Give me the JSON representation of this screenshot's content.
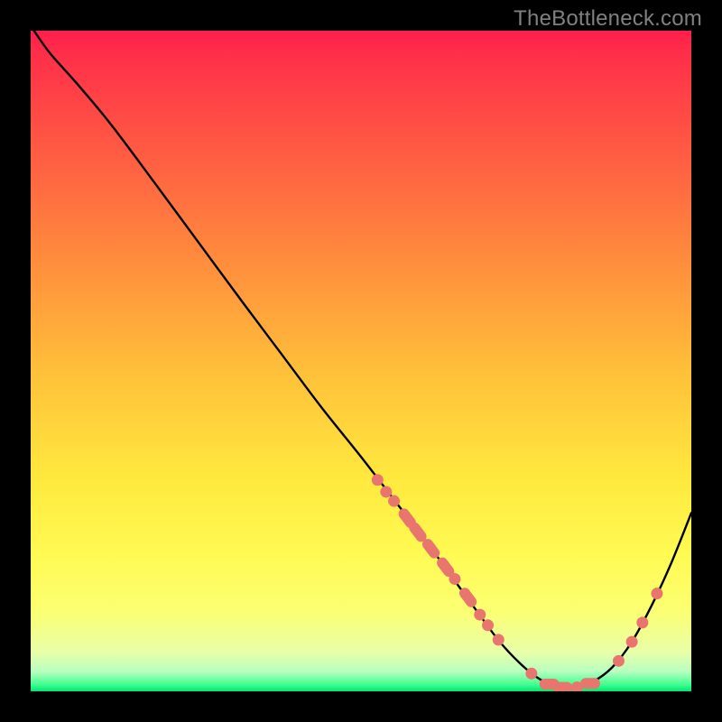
{
  "watermark": "TheBottleneck.com",
  "colors": {
    "gradient_top": "#ff1f4b",
    "gradient_bottom": "#00e472",
    "curve": "#000000",
    "dots": "#e8766e",
    "frame": "#000000",
    "watermark": "#808080"
  },
  "chart_data": {
    "type": "line",
    "title": "",
    "xlabel": "",
    "ylabel": "",
    "xlim": [
      0,
      100
    ],
    "ylim": [
      0,
      100
    ],
    "note": "Axes are unlabeled; values are read as percentage positions within the plot area (0=left/bottom, 100=right/top).",
    "series": [
      {
        "name": "curve",
        "x": [
          0.5,
          3,
          7,
          12,
          18,
          25,
          32,
          38,
          44,
          50,
          55,
          60,
          64,
          68,
          71,
          74,
          76.5,
          79,
          82,
          85,
          88,
          91,
          94,
          97,
          100
        ],
        "y": [
          100,
          96.5,
          92,
          86,
          78,
          68.5,
          59,
          51,
          43,
          35.5,
          29,
          22.5,
          17,
          11.5,
          7.5,
          4.3,
          2.2,
          0.9,
          0.5,
          1.4,
          3.6,
          7.5,
          13,
          19.5,
          27
        ]
      }
    ],
    "markers": [
      {
        "group": "left_cluster",
        "x": 52.5,
        "y": 32,
        "shape": "dot"
      },
      {
        "group": "left_cluster",
        "x": 53.8,
        "y": 30.2,
        "shape": "dot"
      },
      {
        "group": "left_cluster",
        "x": 55.0,
        "y": 28.8,
        "shape": "dot"
      },
      {
        "group": "left_cluster",
        "x": 57.0,
        "y": 26.2,
        "shape": "pill"
      },
      {
        "group": "left_cluster",
        "x": 58.6,
        "y": 24.1,
        "shape": "pill"
      },
      {
        "group": "left_cluster",
        "x": 60.6,
        "y": 21.6,
        "shape": "pill"
      },
      {
        "group": "left_cluster",
        "x": 62.8,
        "y": 18.8,
        "shape": "pill"
      },
      {
        "group": "left_cluster",
        "x": 64.2,
        "y": 17.0,
        "shape": "dot"
      },
      {
        "group": "left_cluster",
        "x": 66.2,
        "y": 14.2,
        "shape": "pill"
      },
      {
        "group": "left_cluster",
        "x": 68.0,
        "y": 11.6,
        "shape": "dot"
      },
      {
        "group": "left_cluster",
        "x": 69.2,
        "y": 10.0,
        "shape": "dot"
      },
      {
        "group": "left_cluster",
        "x": 70.8,
        "y": 7.8,
        "shape": "dot"
      },
      {
        "group": "bottom",
        "x": 75.8,
        "y": 2.7,
        "shape": "dot"
      },
      {
        "group": "bottom",
        "x": 78.5,
        "y": 1.1,
        "shape": "pill_h"
      },
      {
        "group": "bottom",
        "x": 80.5,
        "y": 0.6,
        "shape": "pill_h"
      },
      {
        "group": "bottom",
        "x": 82.7,
        "y": 0.6,
        "shape": "dot"
      },
      {
        "group": "bottom",
        "x": 84.7,
        "y": 1.2,
        "shape": "pill_h"
      },
      {
        "group": "right_cluster",
        "x": 89.0,
        "y": 4.6,
        "shape": "dot"
      },
      {
        "group": "right_cluster",
        "x": 91.0,
        "y": 7.5,
        "shape": "dot"
      },
      {
        "group": "right_cluster",
        "x": 92.6,
        "y": 10.4,
        "shape": "dot"
      },
      {
        "group": "right_cluster",
        "x": 94.8,
        "y": 14.8,
        "shape": "dot"
      }
    ]
  }
}
